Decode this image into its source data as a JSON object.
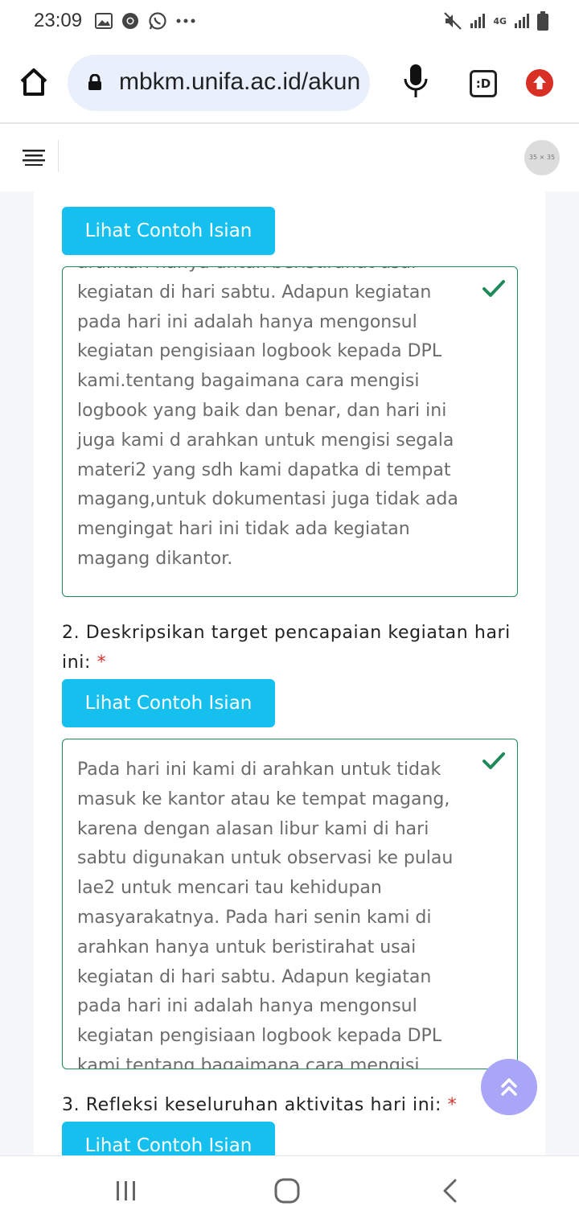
{
  "status_bar": {
    "time": "23:09",
    "left_icons": [
      "gallery-icon",
      "chrome-icon",
      "whatsapp-icon",
      "more-dots-icon"
    ],
    "right_icons": [
      "mute-icon",
      "signal-icon",
      "4g-icon",
      "signal-icon",
      "battery-icon"
    ],
    "network_label": "4G"
  },
  "browser": {
    "url": "mbkm.unifa.ac.id/akun",
    "tabs_label": ":D",
    "accent_color": "#d93025"
  },
  "app_bar": {
    "avatar_placeholder": "35 × 35"
  },
  "form": {
    "sections": [
      {
        "button_label": "Lihat Contoh Isian",
        "answer_text": "arahkan hanya untuk beristirahat usai kegiatan di hari sabtu. Adapun kegiatan pada hari ini adalah hanya mengonsul kegiatan pengisiaan logbook kepada DPL kami.tentang bagaimana cara mengisi logbook yang baik dan benar, dan hari ini juga kami d arahkan untuk mengisi segala materi2 yang sdh kami dapatka di tempat magang,untuk dokumentasi juga tidak ada mengingat hari ini tidak ada kegiatan magang dikantor."
      },
      {
        "question": "2. Deskripsikan target pencapaian kegiatan hari ini:",
        "required_mark": "*",
        "button_label": "Lihat Contoh Isian",
        "answer_text": "Pada hari ini kami di arahkan untuk tidak masuk ke kantor atau ke tempat magang, karena dengan alasan libur kami di hari sabtu digunakan untuk observasi ke pulau lae2 untuk mencari tau kehidupan masyarakatnya. Pada hari senin kami di arahkan hanya untuk beristirahat usai kegiatan di hari sabtu. Adapun kegiatan pada hari ini adalah hanya mengonsul kegiatan pengisiaan logbook kepada DPL kami.tentang bagaimana cara mengisi"
      },
      {
        "question": "3. Refleksi keseluruhan aktivitas hari ini:",
        "required_mark": "*",
        "button_label": "Lihat Contoh Isian"
      }
    ]
  },
  "colors": {
    "button_bg": "#16c0ee",
    "valid_border": "#1e8a5a",
    "required": "#d9342b",
    "scroll_top_bg": "#a9a6f7"
  }
}
